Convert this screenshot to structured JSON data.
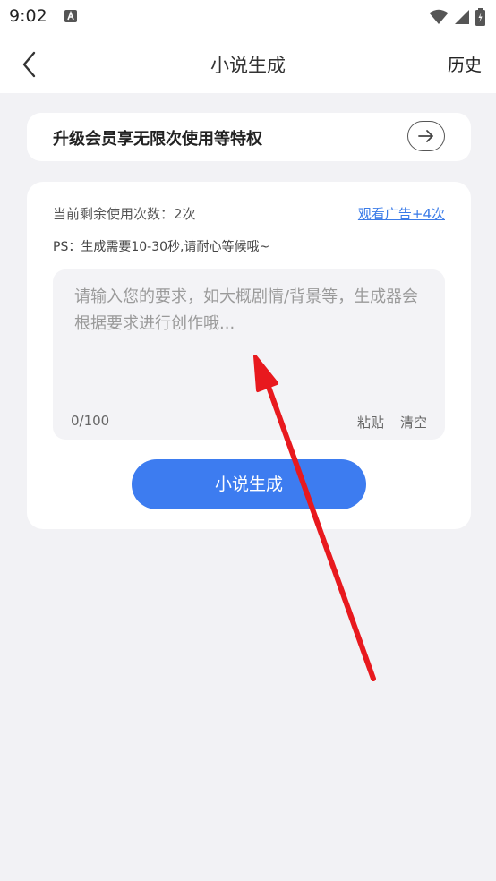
{
  "status_bar": {
    "time": "9:02"
  },
  "header": {
    "title": "小说生成",
    "history_label": "历史"
  },
  "vip_banner": {
    "text": "升级会员享无限次使用等特权"
  },
  "card": {
    "remaining_label": "当前剩余使用次数：2次",
    "watch_ad_label": "观看广告+4次",
    "ps_text": "PS：生成需要10-30秒,请耐心等候哦~",
    "input": {
      "value": "",
      "placeholder": "请输入您的要求，如大概剧情/背景等，生成器会根据要求进行创作哦..."
    },
    "char_count": "0/100",
    "paste_label": "粘贴",
    "clear_label": "清空",
    "generate_label": "小说生成"
  },
  "colors": {
    "accent": "#3d7cf0",
    "link": "#3a7be8",
    "background": "#f2f2f5",
    "annotation_arrow": "#e8191e"
  },
  "icons": {
    "back": "chevron-left-icon",
    "banner_arrow": "arrow-right-icon",
    "wifi": "wifi-icon",
    "signal": "signal-icon",
    "battery": "battery-icon",
    "notification": "a-notification-icon"
  }
}
